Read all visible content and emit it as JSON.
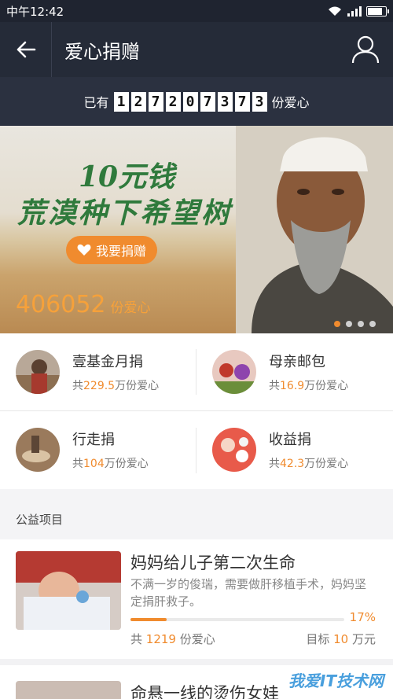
{
  "status_bar": {
    "time": "中午12:42",
    "battery_level": 0.9
  },
  "header": {
    "title": "爱心捐赠",
    "back_icon": "back-arrow-icon",
    "user_icon": "user-icon"
  },
  "counter": {
    "prefix": "已有",
    "digits": [
      "1",
      "2",
      "7",
      "2",
      "0",
      "7",
      "3",
      "7",
      "3"
    ],
    "suffix": "份爱心"
  },
  "banner": {
    "title_line1": "10元钱",
    "title_line2": "荒漠种下希望树",
    "donate_button": "我要捐赠",
    "count": "406052",
    "count_unit": "份爱心",
    "slides": 4,
    "active_slide": 1
  },
  "categories": [
    {
      "name": "壹基金月捐",
      "prefix": "共",
      "amount": "229.5",
      "suffix": "万份爱心"
    },
    {
      "name": "母亲邮包",
      "prefix": "共",
      "amount": "16.9",
      "suffix": "万份爱心"
    },
    {
      "name": "行走捐",
      "prefix": "共",
      "amount": "104",
      "suffix": "万份爱心"
    },
    {
      "name": "收益捐",
      "prefix": "共",
      "amount": "42.3",
      "suffix": "万份爱心"
    }
  ],
  "section": {
    "title": "公益项目"
  },
  "projects": [
    {
      "title": "妈妈给儿子第二次生命",
      "description": "不满一岁的俊瑞，需要做肝移植手术，妈妈坚定捐肝救子。",
      "percent_text": "17%",
      "progress": 0.17,
      "donors_prefix": "共",
      "donors": "1219",
      "donors_suffix": "份爱心",
      "target_prefix": "目标",
      "target": "10",
      "target_suffix": "万元"
    },
    {
      "title": "命悬一线的烫伤女娃"
    }
  ],
  "watermark": {
    "site": "我爱IT技术网"
  },
  "colors": {
    "accent": "#f08b2e",
    "header_bg": "#252b38",
    "counter_bg": "#2b3140"
  }
}
